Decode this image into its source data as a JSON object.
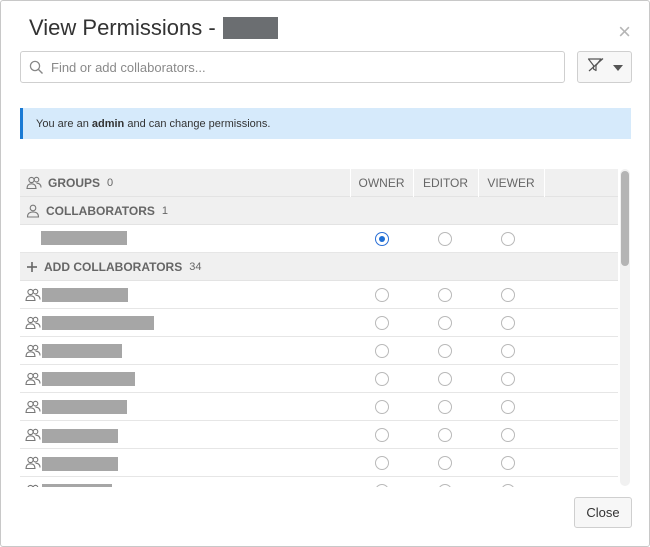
{
  "dialog": {
    "title": "View Permissions -",
    "close_icon": "×"
  },
  "search": {
    "placeholder": "Find or add collaborators...",
    "value": "",
    "icon": "search-icon"
  },
  "filter": {
    "icon": "filter-icon",
    "dropdown_icon": "caret-down-icon"
  },
  "info": {
    "prefix": "You are an ",
    "role": "admin",
    "suffix": " and can change permissions."
  },
  "columns": [
    "OWNER",
    "EDITOR",
    "VIEWER"
  ],
  "sections": {
    "groups": {
      "label": "GROUPS",
      "count": "0"
    },
    "collaborators": {
      "label": "COLLABORATORS",
      "count": "1"
    },
    "add": {
      "label": "ADD COLLABORATORS",
      "count": "34"
    }
  },
  "collaborators": [
    {
      "role": "owner"
    }
  ],
  "add_rows": 8,
  "footer": {
    "close_label": "Close"
  },
  "colors": {
    "accent": "#1f6fd5",
    "info_bg": "#d6eafb"
  }
}
